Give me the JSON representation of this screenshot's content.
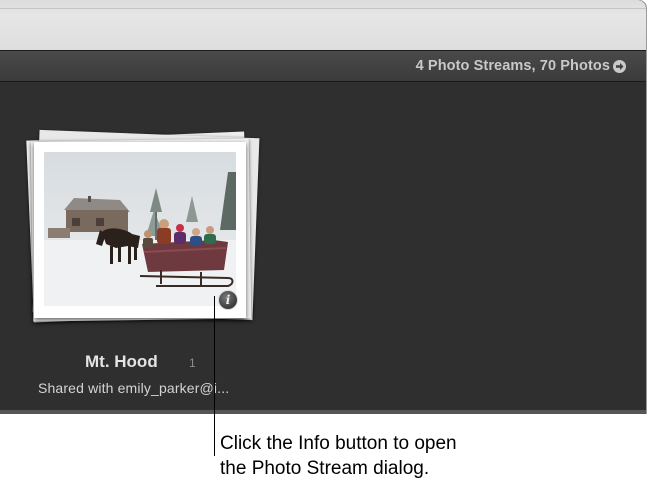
{
  "header": {
    "summary": "4 Photo Streams, 70 Photos",
    "summary_arrow_icon": "right-arrow-circle-icon"
  },
  "stream": {
    "title": "Mt. Hood",
    "count": "1",
    "shared_with": "Shared with emily_parker@i...",
    "info_icon": "info-icon",
    "info_glyph": "i"
  },
  "callout": {
    "line1": "Click the Info button to open",
    "line2": "the Photo Stream dialog."
  },
  "colors": {
    "window_bg": "#2f2f2f",
    "header_bg": "#3f3f3f",
    "label_text": "#e4e4e4"
  }
}
